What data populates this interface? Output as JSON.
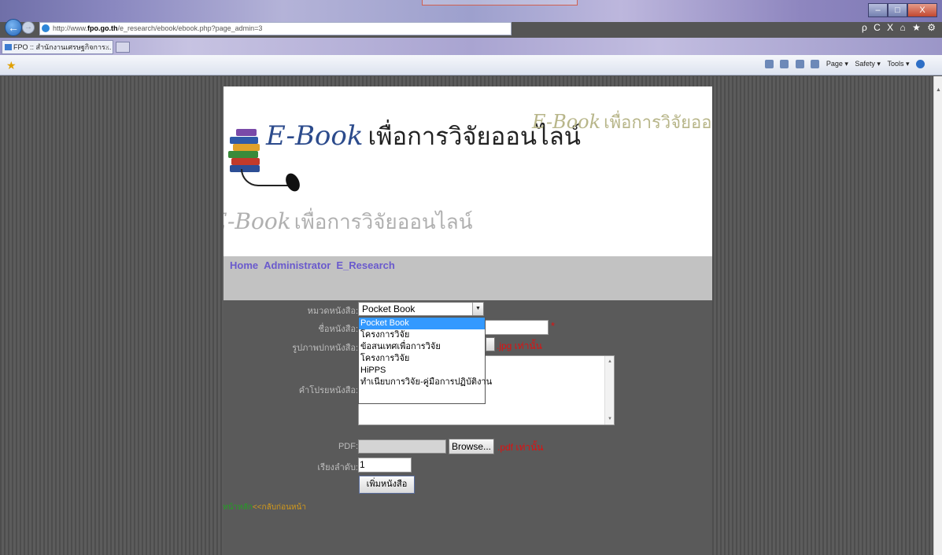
{
  "browser": {
    "url_prefix": "http://www.",
    "url_domain": "fpo.go.th",
    "url_rest": "/e_research/ebook/ebook.php?page_admin=3",
    "tab_title": "FPO :: สำนักงานเศรษฐกิจการ...",
    "tab_close": "×",
    "window_buttons": {
      "min": "–",
      "max": "□",
      "close": "X"
    },
    "nav_right": {
      "search": "ρ",
      "refresh": "C",
      "stop": "X",
      "home": "⌂",
      "fav": "★",
      "tools": "⚙"
    },
    "commands": {
      "page": "Page ▾",
      "safety": "Safety ▾",
      "tools": "Tools ▾"
    }
  },
  "banner": {
    "logo_en": "E-Book",
    "logo_th": "เพื่อการวิจัยออนไลน์"
  },
  "menu": {
    "home": "Home",
    "admin": "Administrator",
    "research": "E_Research"
  },
  "form": {
    "category_label": "หมวดหนังสือ:",
    "category_selected": "Pocket Book",
    "category_options": [
      "Pocket Book",
      "โครงการวิจัย",
      "ข้อสนเทศเพื่อการวิจัย",
      "โครงการวิจัย",
      "HiPPS",
      "ทำเนียบการวิจัย-คู่มือการปฏิบัติงาน"
    ],
    "name_label": "ชื่อหนังสือ:",
    "name_required": "*",
    "cover_label": "รูปภาพปกหนังสือ:",
    "cover_note": ".jpg เท่านั้น",
    "desc_label": "คำโปรยหนังสือ:",
    "pdf_label": "PDF:",
    "browse_label": "Browse...",
    "pdf_note": ".pdf เท่านั้น",
    "order_label": "เรียงลำดับ:",
    "order_value": "1",
    "submit_label": "เพิ่มหนังสือ"
  },
  "footer": {
    "link_green": "หน้าหลัก",
    "link_orange": "<<กลับก่อนหน้า"
  },
  "colors": {
    "menu_link": "#6a5acd",
    "required": "#e01010",
    "selection": "#3399ff"
  }
}
